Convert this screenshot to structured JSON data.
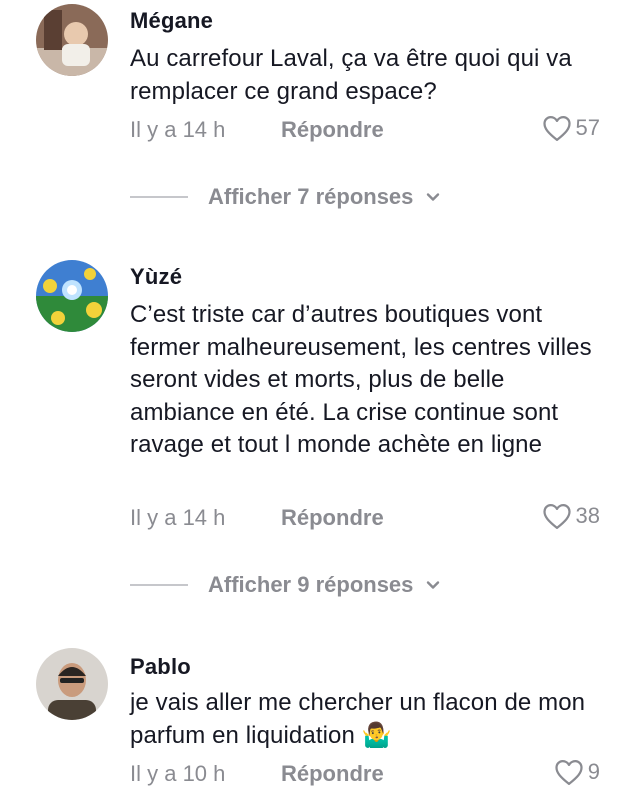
{
  "comments": [
    {
      "username": "Mégane",
      "text": "Au carrefour Laval, ça va être quoi qui va remplacer ce grand espace?",
      "time": "Il y a 14 h",
      "reply_label": "Répondre",
      "likes": "57",
      "view_replies_label": "Afficher 7 réponses"
    },
    {
      "username": "Yùzé",
      "text": "C’est triste car d’autres boutiques vont fermer malheureusement, les centres villes seront vides et morts, plus de belle ambiance en été. La crise continue sont ravage et tout l monde achète en ligne",
      "time": "Il y a 14 h",
      "reply_label": "Répondre",
      "likes": "38",
      "view_replies_label": "Afficher 9 réponses"
    },
    {
      "username": "Pablo",
      "text": "je vais aller me chercher un flacon de mon parfum en liquidation 🤷‍♂️",
      "time": "Il y a 10 h",
      "reply_label": "Répondre",
      "likes": "9"
    }
  ]
}
